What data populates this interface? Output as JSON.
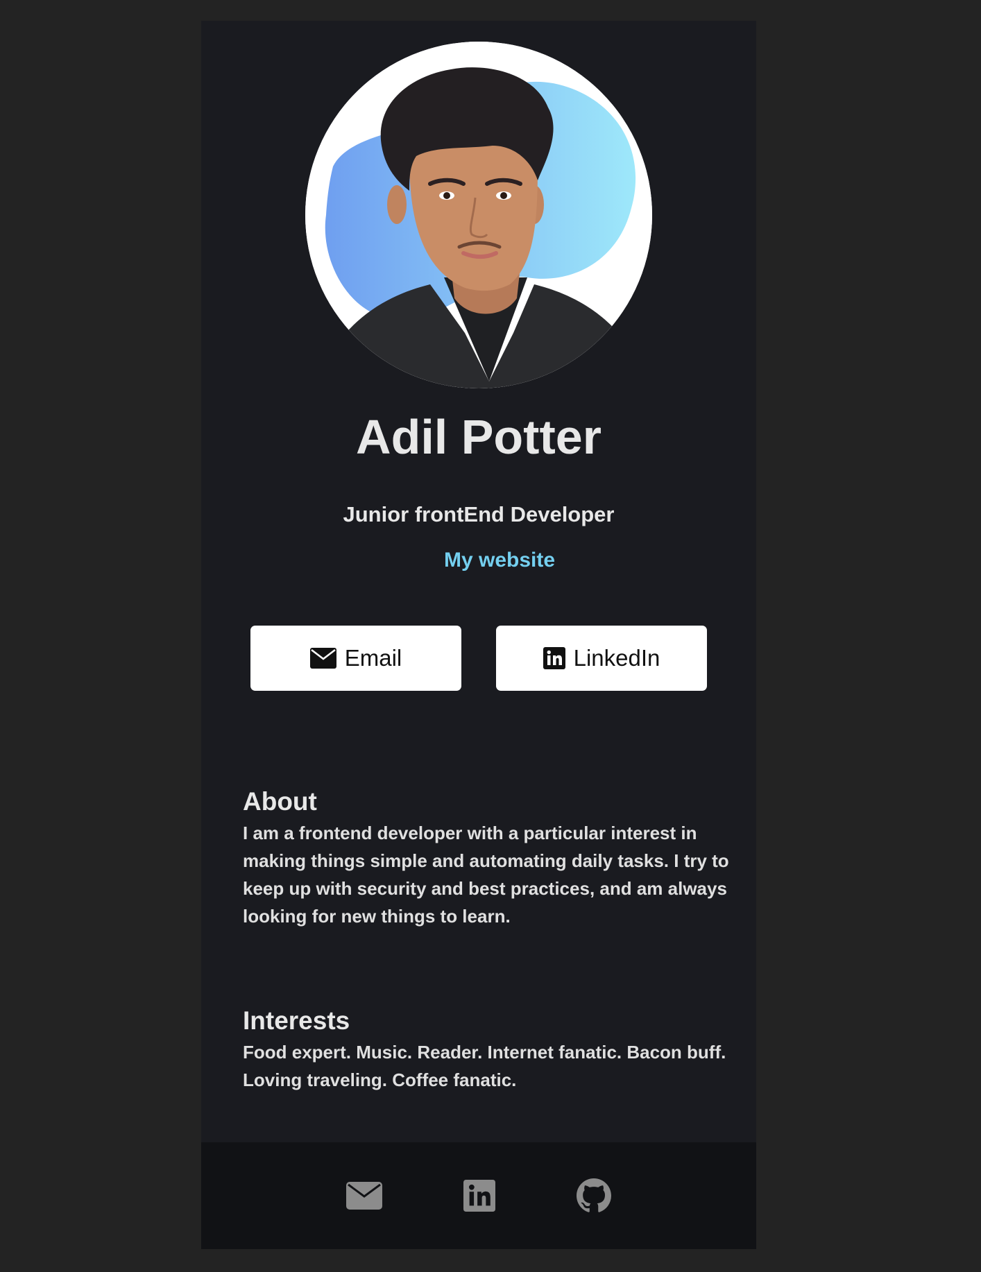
{
  "profile": {
    "name": "Adil Potter",
    "role": "Junior frontEnd Developer",
    "website_label": "My website"
  },
  "buttons": {
    "email_label": "Email",
    "linkedin_label": "LinkedIn"
  },
  "about": {
    "title": "About",
    "text": "I am a frontend developer with a particular interest in making things simple and automating daily tasks. I try to keep up with security and best practices, and am always looking for new things to learn."
  },
  "interests": {
    "title": "Interests",
    "text": "Food expert. Music. Reader. Internet fanatic. Bacon buff. Loving traveling. Coffee fanatic."
  },
  "footer": {
    "icons": [
      "envelope-icon",
      "linkedin-icon",
      "github-icon"
    ]
  },
  "colors": {
    "page_bg": "#232323",
    "card_bg": "#1a1b20",
    "footer_bg": "#111215",
    "link": "#74cfef",
    "text": "#e8e8e8",
    "footer_icon": "#8c8c8c"
  }
}
